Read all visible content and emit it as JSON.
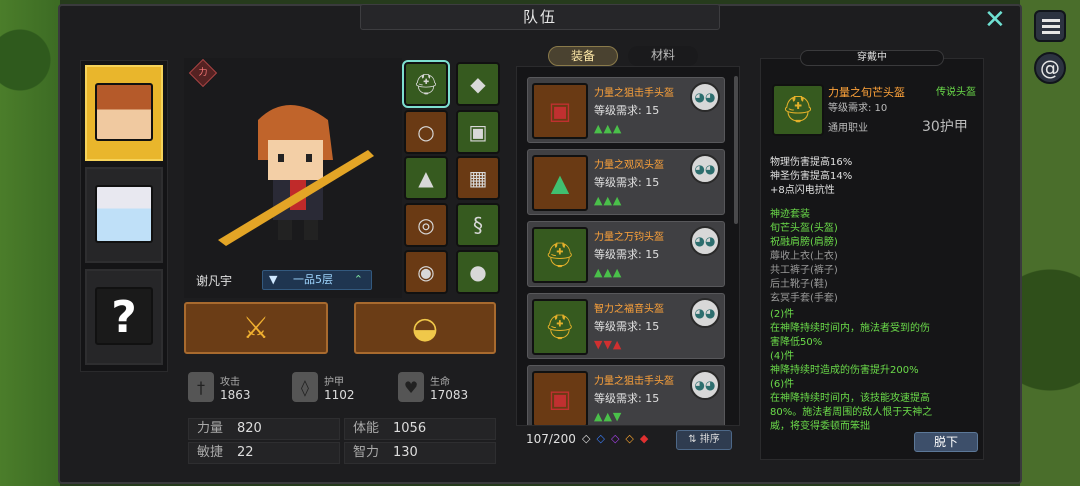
{
  "title": "队伍",
  "tabs": {
    "equip": "装备",
    "material": "材料"
  },
  "wearing_label": "穿戴中",
  "character": {
    "name": "谢凡宇",
    "rank": "一品5层",
    "badge": "力"
  },
  "stats": {
    "atk_label": "攻击",
    "atk": "1863",
    "def_label": "护甲",
    "def": "1102",
    "hp_label": "生命",
    "hp": "17083"
  },
  "attrs": [
    {
      "label": "力量",
      "value": "820"
    },
    {
      "label": "体能",
      "value": "1056"
    },
    {
      "label": "敏捷",
      "value": "22"
    },
    {
      "label": "智力",
      "value": "130"
    }
  ],
  "items": [
    {
      "name": "力量之狙击手头盔",
      "req": "等级需求: 15",
      "cmp": "▲▲▲"
    },
    {
      "name": "力量之观风头盔",
      "req": "等级需求: 15",
      "cmp": "▲▲▲"
    },
    {
      "name": "力量之万钧头盔",
      "req": "等级需求: 15",
      "cmp": "▲▲▲"
    },
    {
      "name": "智力之福音头盔",
      "req": "等级需求: 15",
      "cmp": "▼▼▲"
    },
    {
      "name": "力量之狙击手头盔",
      "req": "等级需求: 15",
      "cmp": "▲▲▼"
    }
  ],
  "capacity": "107/200",
  "sort_label": "排序",
  "equipped": {
    "name": "力量之旬芒头盔",
    "type": "传说头盔",
    "req": "等级需求: 10",
    "class": "通用职业",
    "armor": "30护甲",
    "stats": [
      "物理伤害提高16%",
      "神圣伤害提高14%",
      "+8点闪电抗性"
    ],
    "set_title": "神迹套装",
    "set_items": [
      "旬芒头盔(头盔)",
      "祝融肩膀(肩膀)",
      "蓐收上衣(上衣)",
      "共工裤子(裤子)",
      "后土靴子(鞋)",
      "玄冥手套(手套)"
    ],
    "set_bonus": [
      "(2)件",
      "在神降持续时间内，施法者受到的伤",
      "害降低50%",
      "(4)件",
      "神降持续时造成的伤害提升200%",
      "(6)件",
      "在神降持续时间内，该技能攻速提高",
      "80%。施法者周围的敌人恨于天神之",
      "威，将变得委顿而笨拙"
    ]
  },
  "unequip_label": "脱下",
  "colors": {
    "accent": "#6fe0d2",
    "orange_name": "#ffa33a",
    "green_text": "#6bdc4a",
    "gold": "#e9b62c"
  }
}
